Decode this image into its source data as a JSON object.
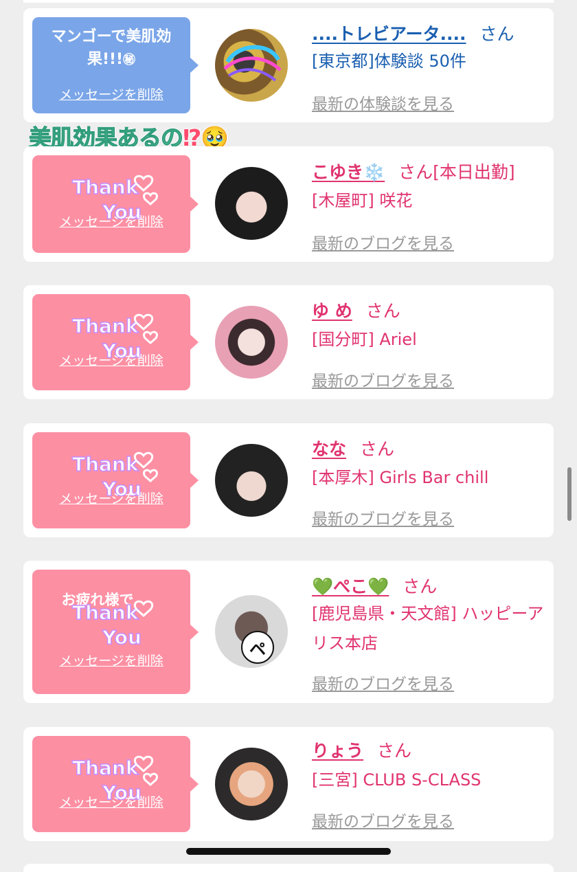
{
  "overlay_caption": {
    "text": "美肌効果あるの",
    "mark": "⁉",
    "emoji": "🥹"
  },
  "delete_label": "メッセージを削除",
  "cards": [
    {
      "bubble_color": "#7aa5e8",
      "bubble_text": "マンゴーで美肌効果!!!",
      "bubble_emoji": "㊙",
      "name": "....トレビアータ....",
      "san": "さん",
      "shop": "[東京都]体験談 50件",
      "link": "最新の体験談を見る",
      "text_color": "#1a5fb0"
    },
    {
      "bubble_color": "#fd8fa3",
      "name": "こゆき❄️",
      "san": "さん",
      "san_extra": "[本日出勤]",
      "shop": "[木屋町] 咲花",
      "link": "最新のブログを見る",
      "text_color": "#e0336f"
    },
    {
      "bubble_color": "#fd8fa3",
      "name": "ゆ め",
      "san": "さん",
      "shop": "[国分町] Ariel",
      "link": "最新のブログを見る",
      "text_color": "#e0336f"
    },
    {
      "bubble_color": "#fd8fa3",
      "name": "なな",
      "san": "さん",
      "shop": "[本厚木] Girls Bar chill",
      "link": "最新のブログを見る",
      "text_color": "#e0336f"
    },
    {
      "bubble_color": "#fd8fa3",
      "bubble_text": "お疲れ様で",
      "name": "💚ぺこ💚",
      "san": "さん",
      "shop": "[鹿児島県・天文館] ハッピーアリス本店",
      "link": "最新のブログを見る",
      "text_color": "#e0336f",
      "avatar_char": "ペ"
    },
    {
      "bubble_color": "#fd8fa3",
      "name": "りょう",
      "san": "さん",
      "shop": "[三宮] CLUB S-CLASS",
      "link": "最新のブログを見る",
      "text_color": "#e0336f"
    }
  ],
  "thanks_sticker": {
    "line1": "Thank",
    "line2": "You"
  }
}
